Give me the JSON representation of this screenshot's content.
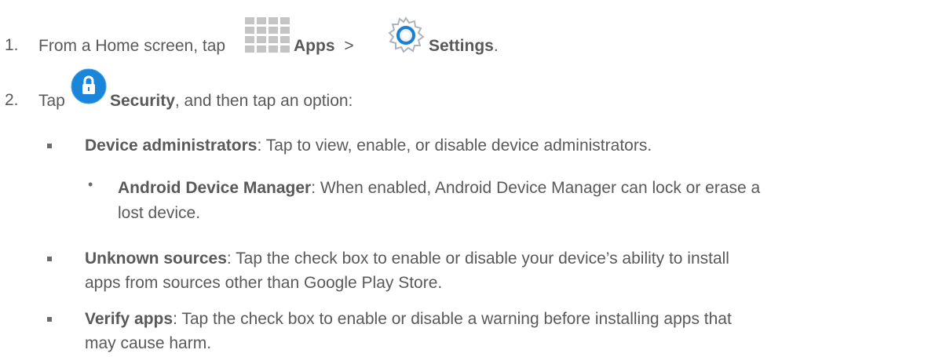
{
  "steps": [
    {
      "number": "1.",
      "text_before": "From a Home screen, tap",
      "apps_label": "Apps",
      "separator": ">",
      "settings_label": "Settings",
      "text_after": "."
    },
    {
      "number": "2.",
      "text_before": "Tap",
      "security_label": "Security",
      "text_after": ", and then tap an option:"
    }
  ],
  "options": [
    {
      "title": "Device administrators",
      "desc": ": Tap to view, enable, or disable device administrators."
    },
    {
      "title": "Unknown sources",
      "desc_line1": ": Tap the check box to enable or disable your device’s ability to install",
      "desc_line2": "apps from sources other than Google Play Store."
    },
    {
      "title": "Verify apps",
      "desc_line1": ": Tap the check box to enable or disable a warning before installing apps that",
      "desc_line2": "may cause harm."
    }
  ],
  "sub_options": [
    {
      "title": "Android Device Manager",
      "desc_line1": ": When enabled, Android Device Manager can lock or erase a",
      "desc_line2": "lost device."
    }
  ],
  "icons": {
    "apps": "apps-grid-icon",
    "settings": "settings-gear-icon",
    "security": "lock-icon"
  },
  "colors": {
    "text": "#595959",
    "apps_icon": "#c4c4c4",
    "security_icon": "#1a86d9",
    "settings_ring": "#1e7fd0"
  }
}
